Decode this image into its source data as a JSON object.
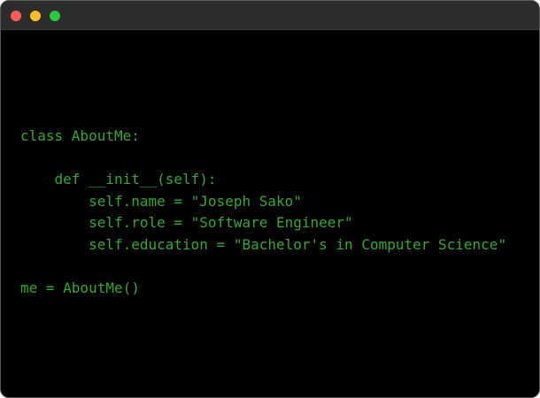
{
  "window": {
    "traffic_lights": {
      "close_color": "#ff5f57",
      "minimize_color": "#febc2e",
      "zoom_color": "#28c840"
    }
  },
  "terminal": {
    "text_color": "#3aa638",
    "background_color": "#000000",
    "lines": [
      "class AboutMe:",
      "",
      "    def __init__(self):",
      "        self.name = \"Joseph Sako\"",
      "        self.role = \"Software Engineer\"",
      "        self.education = \"Bachelor's in Computer Science\"",
      "",
      "me = AboutMe()"
    ]
  }
}
